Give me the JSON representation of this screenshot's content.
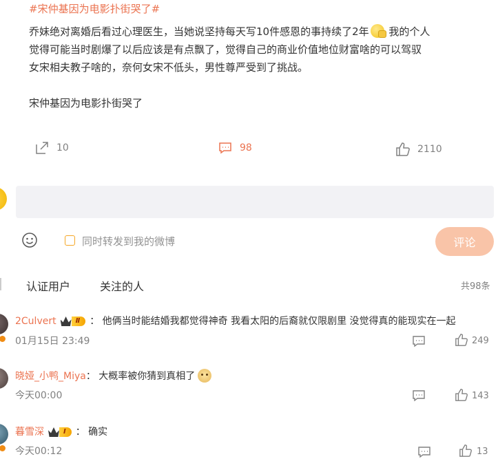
{
  "post": {
    "hashtag": "#宋仲基因为电影扑街哭了#",
    "lines": [
      "乔妹绝对离婚后看过心理医生，当她说坚持每天写10件感恩的事持续了2年",
      "我的个人",
      "觉得可能当时剧爆了以后应该是有点飘了，觉得自己的商业价值地位财富啥的可以驾驭",
      "女宋相夫教子啥的，奈何女宋不低头，男性尊严受到了挑战。",
      "宋仲基因为电影扑街哭了"
    ],
    "emoji": "thinking-emoji"
  },
  "actions": {
    "repost_count": "10",
    "comment_count": "98",
    "like_count": "2110"
  },
  "compose": {
    "input_value": "",
    "forward_label": "同时转发到我的微博",
    "submit_label": "评论"
  },
  "filter": {
    "tabs": [
      "认证用户",
      "关注的人"
    ],
    "total": "共98条"
  },
  "comments": [
    {
      "user": "2Culvert",
      "level": "Ⅱ",
      "text": "： 他俩当时能结婚我都觉得神奇 我看太阳的后裔就仅限剧里 没觉得真的能现实在一起",
      "time": "01月15日 23:49",
      "likes": "249"
    },
    {
      "user": "晓娅_小鸭_Miya",
      "text": "： 大概率被你猜到真相了",
      "emoji": "doge-emoji",
      "time": "今天00:00",
      "likes": "143"
    },
    {
      "user": "暮雪深",
      "level": "Ⅰ",
      "text": "： 确实",
      "time": "今天00:12",
      "likes": "13"
    }
  ],
  "colors": {
    "accent": "#eb7350",
    "muted": "#808080",
    "input_bg": "#f2f2f5",
    "submit_bg": "#f9c4a8"
  }
}
